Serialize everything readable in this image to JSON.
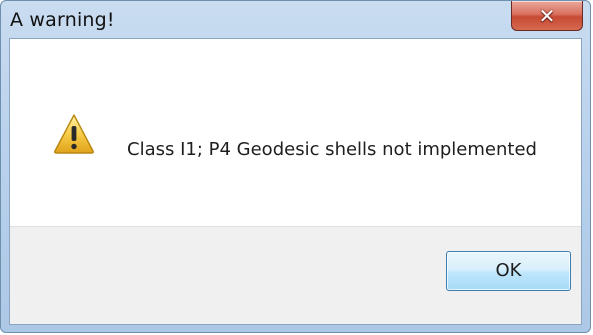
{
  "window": {
    "title": "A warning!",
    "close_icon": "close-icon"
  },
  "message": {
    "icon": "warning-icon",
    "text": "Class I1; P4 Geodesic shells not implemented"
  },
  "buttons": {
    "ok_label": "OK"
  },
  "colors": {
    "title_frame": "#b9d1ec",
    "close_button": "#c74a34",
    "ok_button": "#bee6fd",
    "button_area": "#f0f0f0",
    "warning_fill": "#f2c94c"
  }
}
